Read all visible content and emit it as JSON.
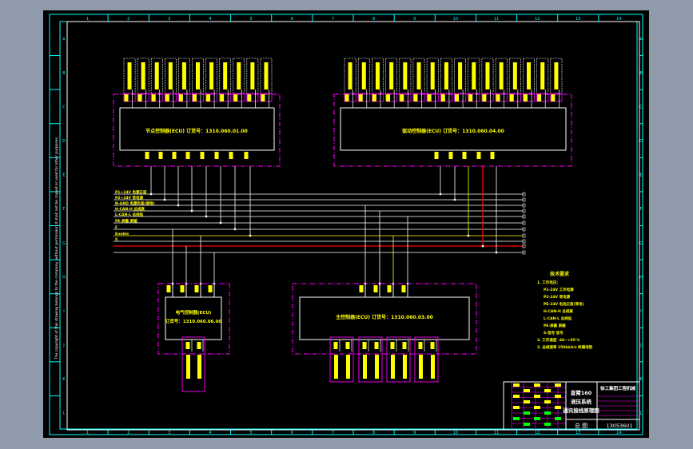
{
  "colors": {
    "background": "#8f9bab",
    "canvas": "#000000",
    "border": "#00ffff",
    "frame": "#ffffff",
    "module_outline": "#ff00ff",
    "text": "#ffff00",
    "wire": "#ffffff",
    "power_wire": "#ffff00",
    "can_wire": "#ff0000"
  },
  "border": {
    "columns": [
      "1",
      "2",
      "3",
      "4",
      "5",
      "6",
      "7",
      "8",
      "9",
      "10",
      "11",
      "12",
      "13",
      "14"
    ],
    "rows": [
      "A",
      "B",
      "C",
      "D",
      "E",
      "F",
      "G",
      "H",
      "I",
      "J",
      "K",
      "L"
    ],
    "side_note": "The copyright of this drawing belongs to the company, without permission it shall not be copied or used for other purposes."
  },
  "modules": {
    "top_left": {
      "title": "节点控制器(ECU) 订货号：1310.060.01.00"
    },
    "top_right": {
      "title": "驱动控制器(ECU) 订货号：1310.060.04.00"
    },
    "bottom_left": {
      "title": "电气控制器(ECU)",
      "order": "订货号：1310.060.06.00"
    },
    "bottom_right": {
      "title": "主控制器(ECU) 订货号：1310.060.03.00"
    }
  },
  "bus_labels": [
    "P1+24V 电源正极",
    "P2+24V 常电源",
    "N-GND 电源负极(接地)",
    "H-CAN-H 总线高",
    "L-CAN-L 总线低",
    "PE-屏蔽 屏蔽",
    "F",
    "Enable",
    "S"
  ],
  "notes": {
    "title": "技术要求",
    "items": [
      "1. 工作电压：",
      "P1-24V  工作电源",
      "P2-24V  常电源",
      "PE-24V  电池正极(常电)",
      "H-CAN-H  总线高",
      "L-CAN-L  总线低",
      "PE-屏蔽  屏蔽",
      "S-信号  信号",
      "2. 工作温度 -40~+85℃",
      "3. 总线速率 250kbit/s 终端电阻"
    ]
  },
  "title_block": {
    "drawing_name": "直臂160 液压系统 通讯接线原理图",
    "company": "徐工集团工程机械",
    "drawing_number": "13053601",
    "sheet": "总 图"
  }
}
